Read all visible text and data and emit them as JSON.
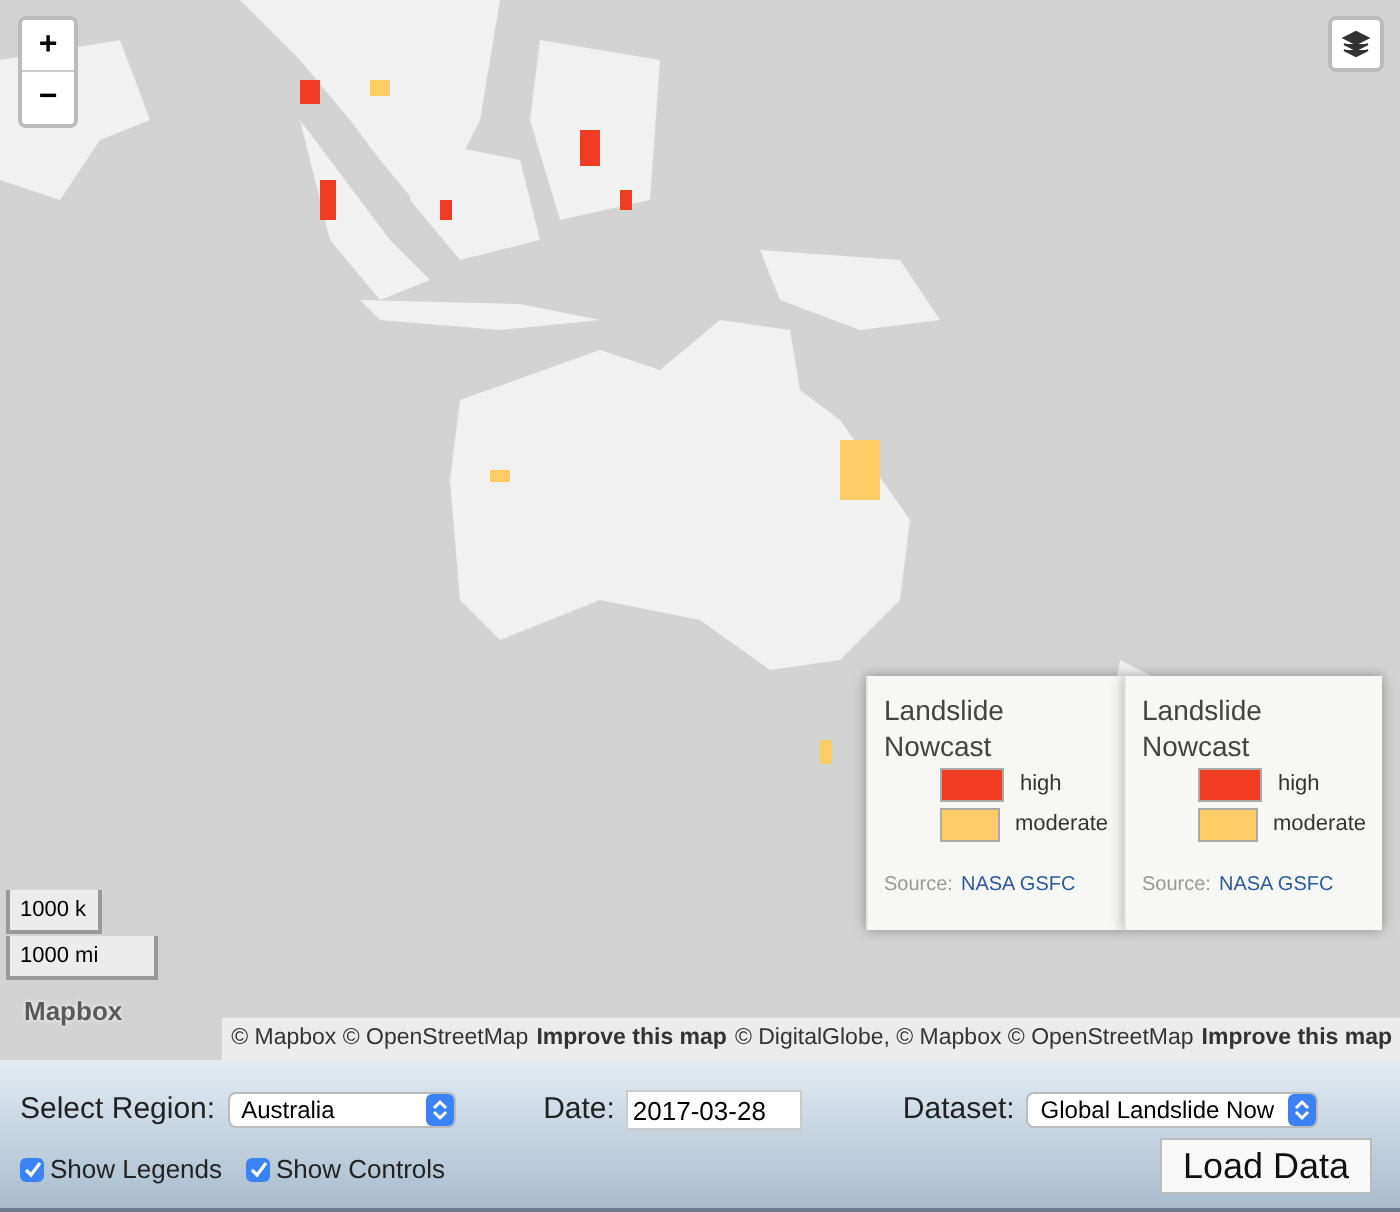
{
  "map": {
    "kind": "picture",
    "zoom_in": "+",
    "zoom_out": "−",
    "scale": [
      "1000 k",
      "1000 mi"
    ],
    "logo": "Mapbox",
    "attribution": [
      {
        "kind": "text",
        "text": "© Mapbox © OpenStreetMap"
      },
      {
        "kind": "link",
        "text": "Improve this map"
      },
      {
        "kind": "text",
        "text": "© DigitalGlobe, © Mapbox © OpenStreetMap"
      },
      {
        "kind": "link",
        "text": "Improve this map"
      }
    ]
  },
  "legends": [
    {
      "title": "Landslide Nowcast",
      "items": [
        {
          "label": "high",
          "color": "#f03c23"
        },
        {
          "label": "moderate",
          "color": "#ffcc66"
        }
      ],
      "source_label": "Source:",
      "source_link": "NASA GSFC"
    },
    {
      "title": "Landslide Nowcast",
      "items": [
        {
          "label": "high",
          "color": "#f03c23"
        },
        {
          "label": "moderate",
          "color": "#ffcc66"
        }
      ],
      "source_label": "Source:",
      "source_link": "NASA GSFC"
    }
  ],
  "controls": {
    "region_label": "Select Region:",
    "region": "Australia",
    "date_label": "Date:",
    "date": "2017-03-28",
    "dataset_label": "Dataset:",
    "dataset": "Global Landslide Now",
    "checkboxes": [
      {
        "label": "Show Legends",
        "checked": true
      },
      {
        "label": "Show Controls",
        "checked": true
      }
    ],
    "button": "Load Data"
  }
}
